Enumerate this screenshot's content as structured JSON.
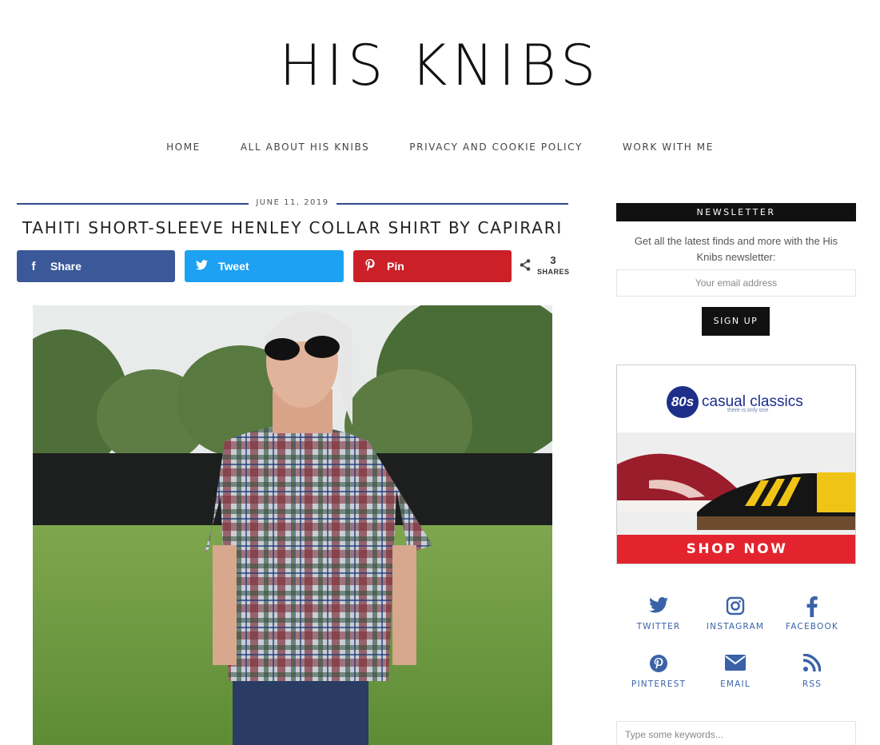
{
  "site": {
    "title": "HIS KNIBS"
  },
  "nav": {
    "items": [
      "HOME",
      "ALL ABOUT HIS KNIBS",
      "PRIVACY AND COOKIE POLICY",
      "WORK WITH ME"
    ]
  },
  "post": {
    "date": "JUNE 11, 2019",
    "title": "TAHITI SHORT-SLEEVE HENLEY COLLAR SHIRT BY CAPIRARI",
    "share": {
      "facebook": "Share",
      "twitter": "Tweet",
      "pinterest": "Pin",
      "count": "3",
      "count_label": "SHARES"
    }
  },
  "sidebar": {
    "newsletter": {
      "heading": "NEWSLETTER",
      "text": "Get all the latest finds and more with the His Knibs newsletter:",
      "placeholder": "Your email address",
      "button": "SIGN UP"
    },
    "ad": {
      "badge": "80s",
      "brand": "casual classics",
      "tagline": "there is only one",
      "cta": "SHOP NOW"
    },
    "social": [
      {
        "label": "TWITTER",
        "icon": "twitter-icon"
      },
      {
        "label": "INSTAGRAM",
        "icon": "instagram-icon"
      },
      {
        "label": "FACEBOOK",
        "icon": "facebook-icon"
      },
      {
        "label": "PINTEREST",
        "icon": "pinterest-icon"
      },
      {
        "label": "EMAIL",
        "icon": "email-icon"
      },
      {
        "label": "RSS",
        "icon": "rss-icon"
      }
    ],
    "search_placeholder": "Type some keywords..."
  },
  "colors": {
    "accent": "#3a62a8",
    "facebook": "#3b5998",
    "twitter": "#1da1f2",
    "pinterest": "#cb2027",
    "ad_red": "#e3232d"
  }
}
